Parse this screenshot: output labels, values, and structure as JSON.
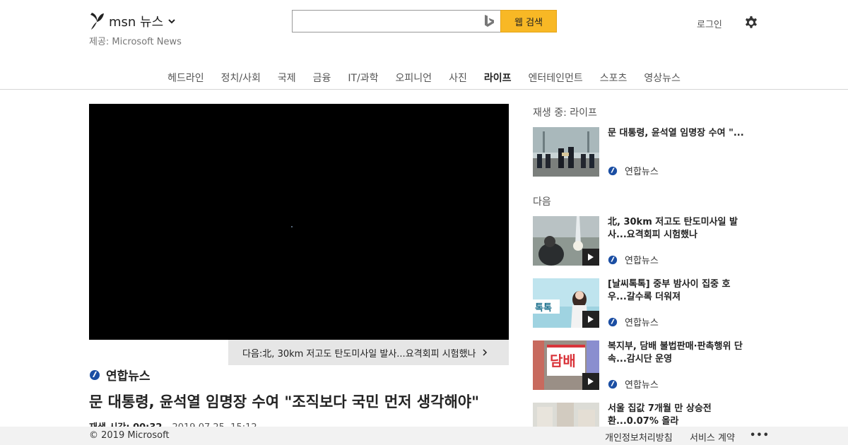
{
  "header": {
    "brand": "msn 뉴스",
    "powered_by": "제공: Microsoft News",
    "search": {
      "placeholder": "",
      "button": "웹 검색"
    },
    "login": "로그인"
  },
  "nav": {
    "items": [
      "헤드라인",
      "정치/사회",
      "국제",
      "금융",
      "IT/과학",
      "오피니언",
      "사진",
      "라이프",
      "엔터테인먼트",
      "스포츠",
      "영상뉴스"
    ],
    "active": "라이프"
  },
  "video": {
    "next_label": "다음:北, 30km 저고도 탄도미사일 발사...요격회피 시험했나",
    "source": "연합뉴스",
    "headline": "문 대통령, 윤석열 임명장 수여 \"조직보다 국민 먼저 생각해야\"",
    "duration_label": "재생 시간: 00:32",
    "date": "2019.07.25. 15:12"
  },
  "sidebar": {
    "now_playing_label": "재생 중: 라이프",
    "next_label": "다음",
    "now_playing": {
      "title": "문 대통령, 윤석열 임명장 수여 \"...",
      "source": "연합뉴스"
    },
    "up_next": [
      {
        "title": "北, 30km 저고도 탄도미사일 발사...요격회피 시험했나",
        "source": "연합뉴스"
      },
      {
        "title": "[날씨톡톡] 중부 밤사이 집중 호우...갈수록 더워져",
        "source": "연합뉴스",
        "thumb_text": "톡톡"
      },
      {
        "title": "복지부, 담배 불법판매·판촉행위 단속...감시단 운영",
        "source": "연합뉴스",
        "thumb_text": "담배"
      },
      {
        "title": "서울 집값 7개월 만 상승전환...0.07% 올라",
        "source": ""
      }
    ]
  },
  "footer": {
    "copyright": "© 2019 Microsoft",
    "privacy": "개인정보처리방침",
    "terms": "서비스 계약",
    "more": "•••"
  },
  "colors": {
    "search_button": "#f8b825",
    "yonhap_blue": "#1b4ea3"
  }
}
